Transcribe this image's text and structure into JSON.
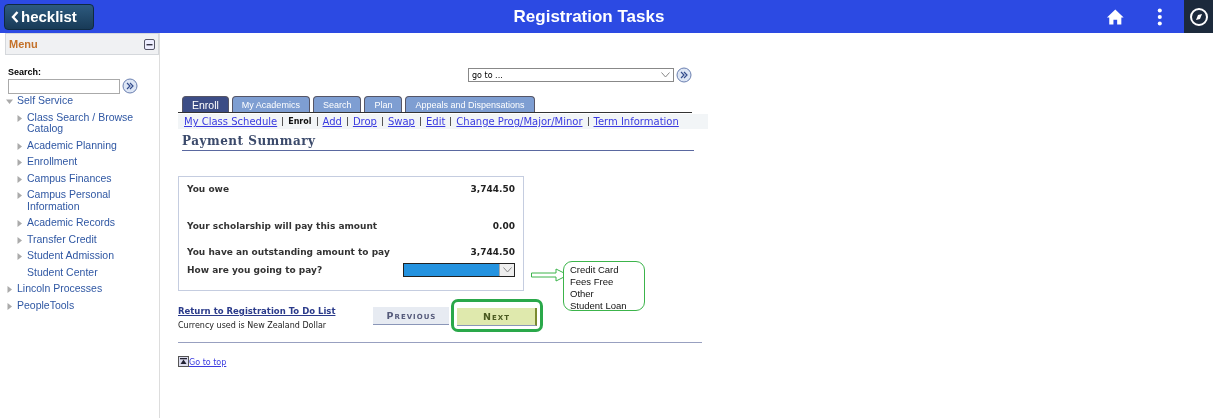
{
  "header": {
    "back_button": "hecklist",
    "title": "Registration Tasks"
  },
  "sidebar": {
    "title": "Menu",
    "search_label": "Search:",
    "items": [
      {
        "label": "Self Service",
        "expanded": true,
        "children": [
          {
            "label": "Class Search / Browse Catalog",
            "expanded": false
          },
          {
            "label": "Academic Planning",
            "expanded": false
          },
          {
            "label": "Enrollment",
            "expanded": false
          },
          {
            "label": "Campus Finances",
            "expanded": false
          },
          {
            "label": "Campus Personal Information",
            "expanded": false
          },
          {
            "label": "Academic Records",
            "expanded": false
          },
          {
            "label": "Transfer Credit",
            "expanded": false
          },
          {
            "label": "Student Admission",
            "expanded": false
          },
          {
            "label": "Student Center",
            "kind": "leaf"
          }
        ]
      },
      {
        "label": "Lincoln Processes",
        "expanded": false
      },
      {
        "label": "PeopleTools",
        "expanded": false
      }
    ]
  },
  "goto": {
    "value": "go to ..."
  },
  "tabs": [
    {
      "label": "Enroll",
      "selected": true
    },
    {
      "label": "My Academics",
      "selected": false
    },
    {
      "label": "Search",
      "selected": false
    },
    {
      "label": "Plan",
      "selected": false
    },
    {
      "label": "Appeals and Dispensations",
      "selected": false
    }
  ],
  "subnav": [
    {
      "label": "My Class Schedule",
      "selected": false
    },
    {
      "label": "Enrol",
      "selected": true
    },
    {
      "label": "Add",
      "selected": false
    },
    {
      "label": "Drop",
      "selected": false
    },
    {
      "label": "Swap",
      "selected": false
    },
    {
      "label": "Edit",
      "selected": false
    },
    {
      "label": "Change Prog/Major/Minor",
      "selected": false
    },
    {
      "label": "Term Information",
      "selected": false
    }
  ],
  "page_title": "Payment Summary",
  "summary": [
    {
      "label": "You owe",
      "value": "3,744.50"
    },
    {
      "label": "Your scholarship will pay this amount",
      "value": "0.00"
    },
    {
      "label": "You have an outstanding amount to pay",
      "value": "3,744.50"
    }
  ],
  "pay_question": "How are you going to pay?",
  "annotation_options": [
    "Credit Card",
    "Fees Free",
    "Other",
    "Student Loan"
  ],
  "return_link": "Return to Registration To Do List",
  "currency_note": "Currency used is New Zealand Dollar",
  "buttons": [
    {
      "label": "Previous",
      "highlighted": false
    },
    {
      "label": "Next",
      "highlighted": true
    }
  ],
  "go_to_top": "Go to top"
}
